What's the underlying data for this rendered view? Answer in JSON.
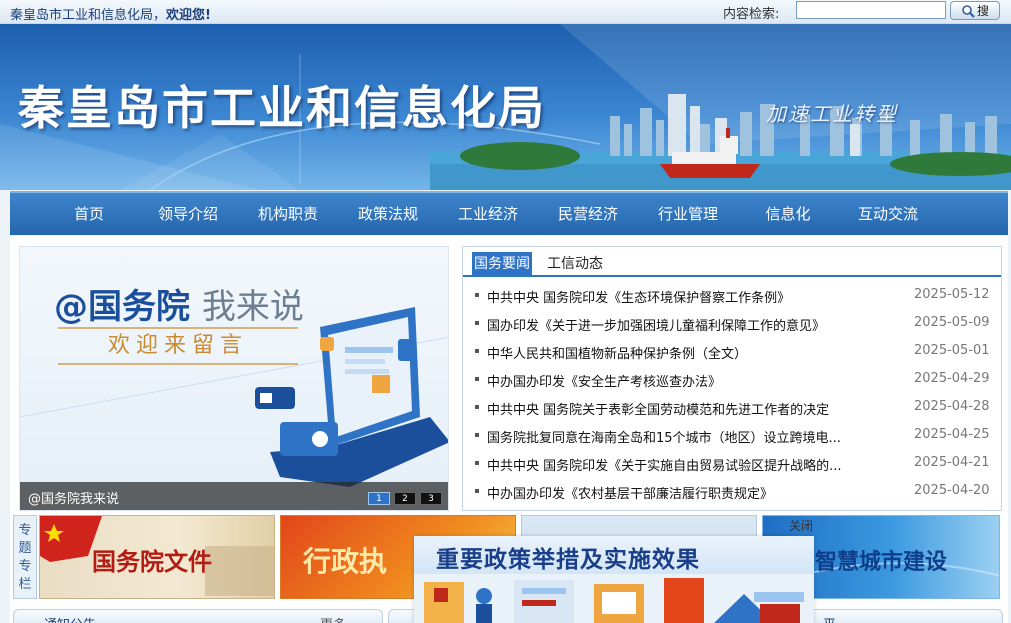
{
  "header": {
    "site_name": "秦皇岛市工业和信息化局，",
    "greeting": "欢迎您!",
    "search_label": "内容检索:",
    "search_value": "",
    "search_button": "搜"
  },
  "banner": {
    "title": "秦皇岛市工业和信息化局",
    "slogan": "加速工业转型"
  },
  "nav": {
    "items": [
      {
        "label": "首页"
      },
      {
        "label": "领导介绍"
      },
      {
        "label": "机构职责"
      },
      {
        "label": "政策法规"
      },
      {
        "label": "工业经济"
      },
      {
        "label": "民营经济"
      },
      {
        "label": "行业管理"
      },
      {
        "label": "信息化"
      },
      {
        "label": "互动交流"
      }
    ]
  },
  "slider": {
    "heading_main": "@国务院",
    "heading_light": "我来说",
    "subheading": "欢迎来留言",
    "caption": "@国务院我来说",
    "dots": [
      "1",
      "2",
      "3"
    ],
    "active_dot": 1
  },
  "news": {
    "tabs": [
      {
        "label": "国务要闻"
      },
      {
        "label": "工信动态"
      }
    ],
    "items": [
      {
        "title": "中共中央 国务院印发《生态环境保护督察工作条例》",
        "date": "2025-05-12"
      },
      {
        "title": "国办印发《关于进一步加强困境儿童福利保障工作的意见》",
        "date": "2025-05-09"
      },
      {
        "title": "中华人民共和国植物新品种保护条例（全文）",
        "date": "2025-05-01"
      },
      {
        "title": "中办国办印发《安全生产考核巡查办法》",
        "date": "2025-04-29"
      },
      {
        "title": "中共中央 国务院关于表彰全国劳动模范和先进工作者的决定",
        "date": "2025-04-28"
      },
      {
        "title": "国务院批复同意在海南全岛和15个城市（地区）设立跨境电...",
        "date": "2025-04-25"
      },
      {
        "title": "中共中央 国务院印发《关于实施自由贸易试验区提升战略的...",
        "date": "2025-04-21"
      },
      {
        "title": "中办国办印发《农村基层干部廉洁履行职责规定》",
        "date": "2025-04-20"
      }
    ]
  },
  "topics": {
    "label": "专题专栏",
    "items": [
      {
        "label": "国务院文件"
      },
      {
        "label": "行政执"
      },
      {
        "label": ""
      },
      {
        "label": "智慧城市建设"
      }
    ]
  },
  "bottom": {
    "notice_tab": "通知公告",
    "more": "更多",
    "right_tab": "平"
  },
  "popup": {
    "title": "重要政策举措及实施效果",
    "close": "关闭"
  },
  "colors": {
    "primary": "#2f73c6",
    "nav": "#2465ac",
    "accent_red": "#c0281c",
    "gold": "#c98b2f"
  }
}
